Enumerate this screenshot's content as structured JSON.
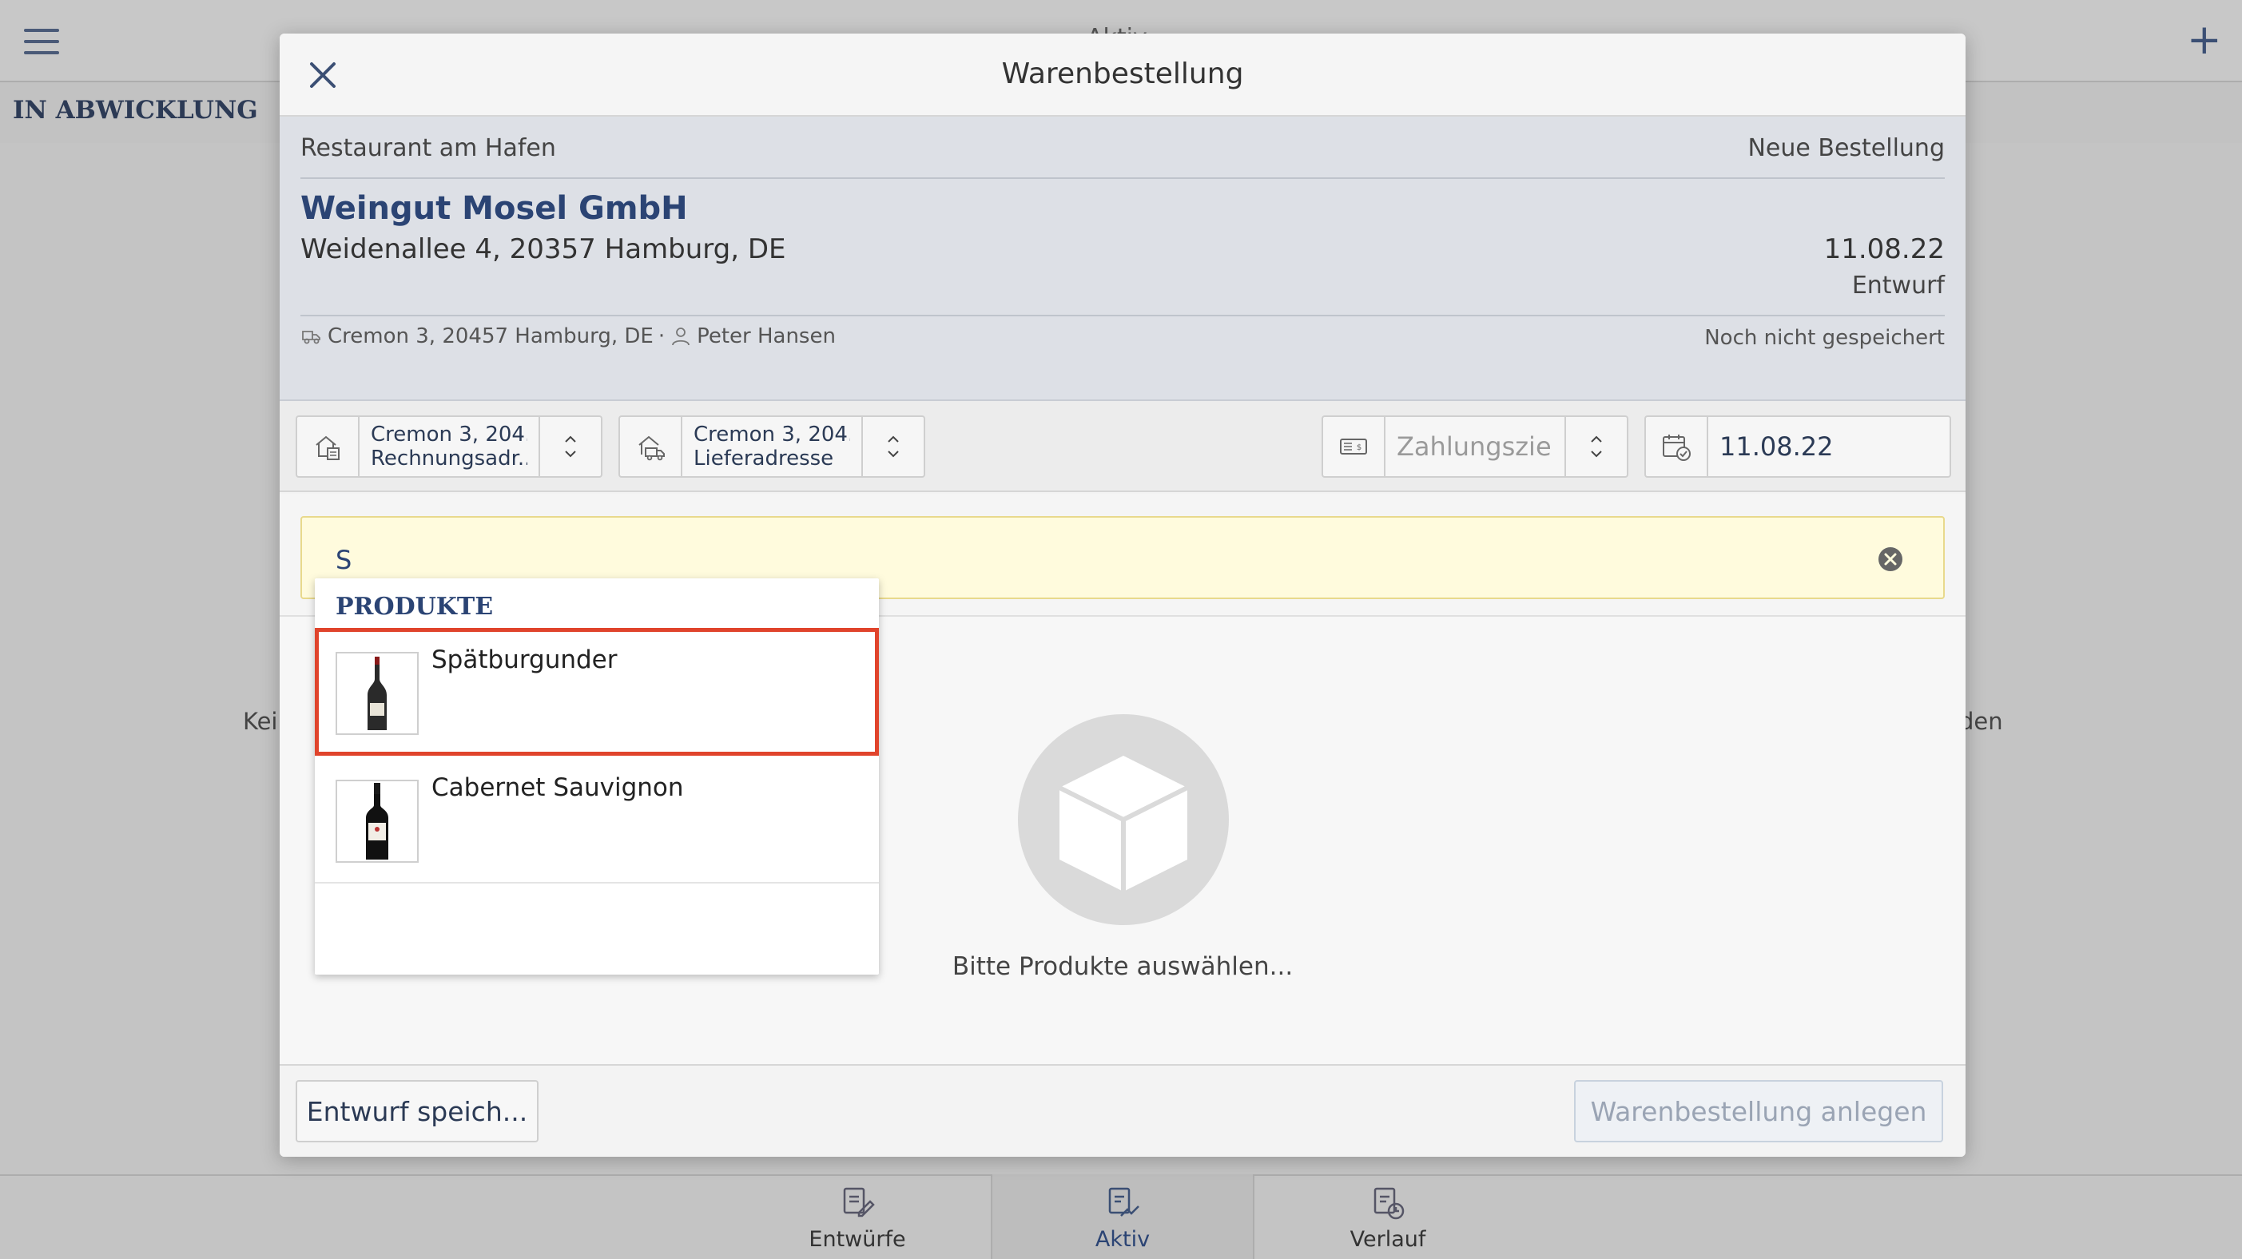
{
  "background": {
    "title": "Aktiv",
    "section_label": "IN ABWICKLUNG",
    "left_text": "Kei",
    "right_text": "den",
    "tabs": [
      {
        "label": "Entwürfe",
        "icon": "drafts-icon"
      },
      {
        "label": "Aktiv",
        "icon": "active-orders-icon"
      },
      {
        "label": "Verlauf",
        "icon": "history-icon"
      }
    ]
  },
  "modal": {
    "title": "Warenbestellung",
    "restaurant": "Restaurant am Hafen",
    "order_type": "Neue Bestellung",
    "supplier": "Weingut Mosel GmbH",
    "supplier_address": "Weidenallee 4, 20357 Hamburg, DE",
    "date": "11.08.22",
    "status": "Entwurf",
    "delivery_address": "Cremon 3, 20457 Hamburg, DE",
    "separator": "·",
    "contact": "Peter Hansen",
    "save_state": "Noch nicht gespeichert"
  },
  "fields": {
    "billing": {
      "line1": "Cremon 3, 204...",
      "line2": "Rechnungsadr..."
    },
    "shipping": {
      "line1": "Cremon 3, 204...",
      "line2": "Lieferadresse"
    },
    "payment": {
      "placeholder": "Zahlungszie....."
    },
    "delivery_date": {
      "value": "11.08.22"
    }
  },
  "search": {
    "value": "S"
  },
  "dropdown": {
    "header": "PRODUKTE",
    "items": [
      {
        "name": "Spätburgunder",
        "selected": true
      },
      {
        "name": "Cabernet Sauvignon",
        "selected": false
      }
    ]
  },
  "empty_state": {
    "text": "Bitte Produkte auswählen..."
  },
  "footer": {
    "draft_label": "Entwurf speich...",
    "create_label": "Warenbestellung anlegen"
  },
  "colors": {
    "accent": "#2b4474",
    "highlight_border": "#e0442c",
    "search_bg": "#fffbdd"
  }
}
